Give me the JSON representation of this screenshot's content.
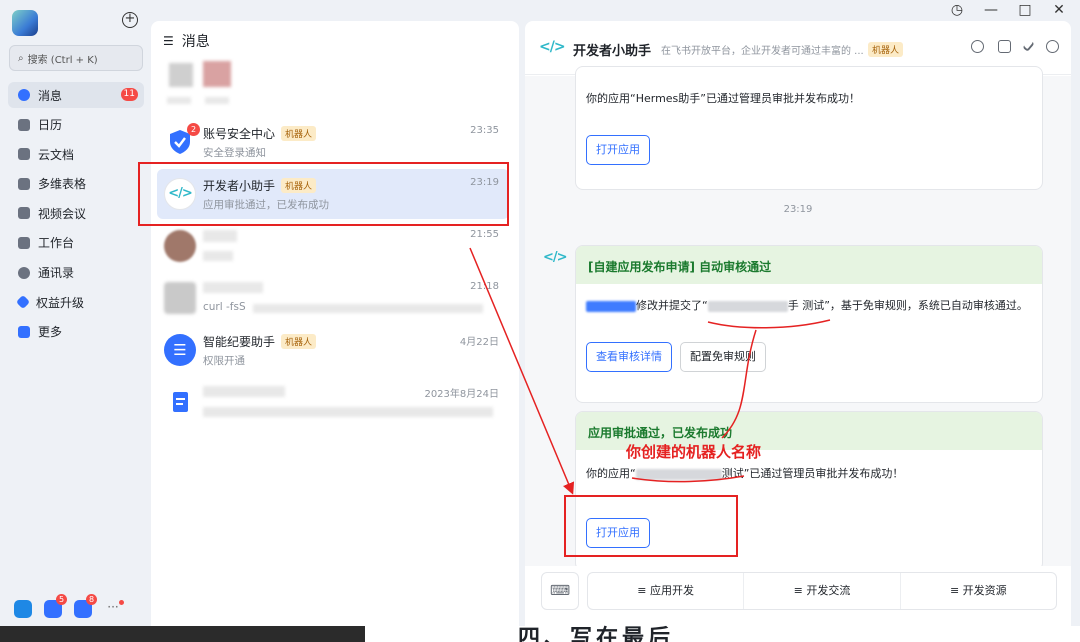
{
  "window": {
    "history_icon": "clock-icon",
    "minimize": "—",
    "maximize": "□",
    "close": "✕"
  },
  "sidebar": {
    "search_placeholder": "搜索 (Ctrl + K)",
    "items": [
      {
        "label": "消息",
        "badge": "11"
      },
      {
        "label": "日历"
      },
      {
        "label": "云文档"
      },
      {
        "label": "多维表格"
      },
      {
        "label": "视频会议"
      },
      {
        "label": "工作台"
      },
      {
        "label": "通讯录"
      },
      {
        "label": "权益升级"
      },
      {
        "label": "更多"
      }
    ],
    "dock_badges": [
      "5",
      "8"
    ]
  },
  "list": {
    "title": "消息",
    "chats": [
      {
        "name": "账号安全中心",
        "tag": "机器人",
        "sub": "安全登录通知",
        "time": "23:35",
        "badge": "2"
      },
      {
        "name": "开发者小助手",
        "tag": "机器人",
        "sub": "应用审批通过，已发布成功",
        "time": "23:19"
      },
      {
        "name": "",
        "sub": "",
        "time": "21:55"
      },
      {
        "name": "",
        "sub": "curl -fsS",
        "time": "21:18"
      },
      {
        "name": "智能纪要助手",
        "tag": "机器人",
        "sub": "权限开通",
        "time": "4月22日"
      },
      {
        "name": "",
        "sub": "",
        "time": "2023年8月24日"
      }
    ]
  },
  "pane": {
    "title": "开发者小助手",
    "desc": "在飞书开放平台，企业开发者可通过丰富的 ...",
    "tag": "机器人",
    "card1": {
      "text": "你的应用“Hermes助手”已通过管理员审批并发布成功！",
      "button": "打开应用"
    },
    "timestamp": "23:19",
    "card2": {
      "header": "[自建应用发布申请] 自动审核通过",
      "text_pre": "修改并提交了“",
      "text_mid": "手 测试",
      "text_post": "”，基于免审规则，系统已自动审核通过。",
      "btn_detail": "查看审核详情",
      "btn_rule": "配置免审规则"
    },
    "card3": {
      "header": "应用审批通过，已发布成功",
      "text_pre": "你的应用“",
      "text_mid": "测试",
      "text_post": "”已通过管理员审批并发布成功！",
      "button": "打开应用"
    },
    "footer": {
      "keyboard_icon": "keyboard-icon",
      "quick": [
        "≡ 应用开发",
        "≡ 开发交流",
        "≡ 开发资源"
      ]
    }
  },
  "annotation": {
    "label": "你创建的机器人名称"
  },
  "underlying_doc": {
    "heading": "四、写在最后"
  }
}
